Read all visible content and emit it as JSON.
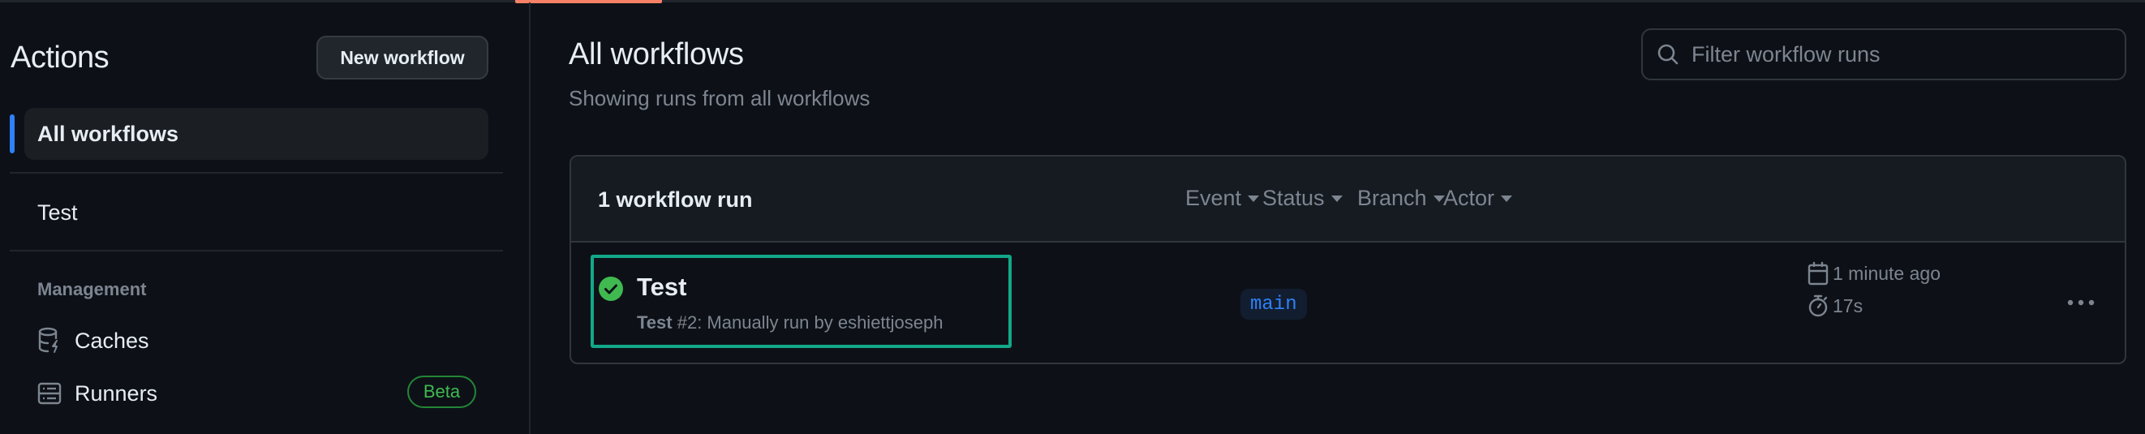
{
  "sidebar": {
    "title": "Actions",
    "new_workflow_label": "New workflow",
    "selected_item": "All workflows",
    "workflows": [
      {
        "label": "Test"
      }
    ],
    "management_heading": "Management",
    "management_items": [
      {
        "label": "Caches",
        "icon": "database-lightning-icon"
      },
      {
        "label": "Runners",
        "icon": "server-icon",
        "badge": "Beta"
      }
    ]
  },
  "main": {
    "title": "All workflows",
    "subtitle": "Showing runs from all workflows",
    "search": {
      "placeholder": "Filter workflow runs",
      "value": ""
    },
    "runs_card": {
      "count_label": "1 workflow run",
      "filters": [
        "Event",
        "Status",
        "Branch",
        "Actor"
      ],
      "runs": [
        {
          "status": "success",
          "title": "Test",
          "meta_workflow": "Test",
          "meta_rest": " #2: Manually run by eshiettjoseph",
          "branch": "main",
          "time_ago": "1 minute ago",
          "duration": "17s"
        }
      ]
    }
  },
  "colors": {
    "accent_blue": "#2f81f7",
    "success_green": "#3fb950",
    "tab_underline": "#f78166",
    "highlight_box": "#12a88a"
  }
}
